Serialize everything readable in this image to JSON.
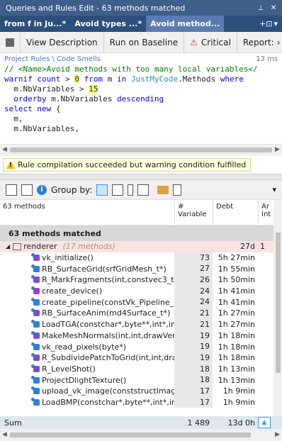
{
  "window": {
    "title": "Queries and Rules Edit  -  63 methods matched"
  },
  "tabs": [
    {
      "label": "from f in Ju...*"
    },
    {
      "label": "Avoid types ...*"
    },
    {
      "label": "Avoid method...",
      "active": true
    }
  ],
  "toolbar": {
    "view_description": "View Description",
    "run_on_baseline": "Run on Baseline",
    "critical": "Critical",
    "report": "Report:"
  },
  "breadcrumb": {
    "text": "Project Rules \\ Code Smells",
    "time": "13 ms"
  },
  "code": {
    "lines": [
      "// <Name>Avoid methods with too many local variables</",
      "warnif count > 0 from m in JustMyCode.Methods where",
      "  m.NbVariables > 15",
      "  orderby m.NbVariables descending",
      "select new {",
      "  m,",
      "  m.NbVariables,"
    ]
  },
  "warning": {
    "text": "Rule compilation succeeded but warning condition fulfilled"
  },
  "results_toolbar": {
    "group_by": "Group by:"
  },
  "table": {
    "headers": {
      "name": "63 methods",
      "variables": "# Variable",
      "debt": "Debt",
      "annual": "Ar Int"
    },
    "group_title": "63 methods matched",
    "parent": {
      "name": "renderer",
      "count": "(17 methods)",
      "debt": "27d",
      "annual": "1"
    },
    "rows": [
      {
        "name": "vk_initialize()",
        "vars": "73",
        "debt": "5h 27min"
      },
      {
        "name": "RB_SurfaceGrid(srfGridMesh_t*)",
        "vars": "27",
        "debt": "1h 55min"
      },
      {
        "name": "R_MarkFragments(int,constvec3_t*,c",
        "vars": "26",
        "debt": "1h 50min"
      },
      {
        "name": "create_device()",
        "vars": "24",
        "debt": "1h 41min"
      },
      {
        "name": "create_pipeline(constVk_Pipeline_De",
        "vars": "24",
        "debt": "1h 41min"
      },
      {
        "name": "RB_SurfaceAnim(md4Surface_t*)",
        "vars": "21",
        "debt": "1h 27min"
      },
      {
        "name": "LoadTGA(constchar*,byte**,int*,int*)",
        "vars": "21",
        "debt": "1h 27min"
      },
      {
        "name": "MakeMeshNormals(int,int,drawVert_t",
        "vars": "19",
        "debt": "1h 18min"
      },
      {
        "name": "vk_read_pixels(byte*)",
        "vars": "19",
        "debt": "1h 18min"
      },
      {
        "name": "R_SubdividePatchToGrid(int,int,draw",
        "vars": "19",
        "debt": "1h 18min"
      },
      {
        "name": "R_LevelShot()",
        "vars": "18",
        "debt": "1h 13min"
      },
      {
        "name": "ProjectDlightTexture()",
        "vars": "18",
        "debt": "1h 13min"
      },
      {
        "name": "upload_vk_image(conststructImage_U",
        "vars": "17",
        "debt": "1h  9min"
      },
      {
        "name": "LoadBMP(constchar*,byte**,int*,int*)",
        "vars": "17",
        "debt": "1h  9min"
      }
    ],
    "sum": {
      "label": "Sum",
      "vars": "1 489",
      "debt": "13d  0h"
    }
  }
}
